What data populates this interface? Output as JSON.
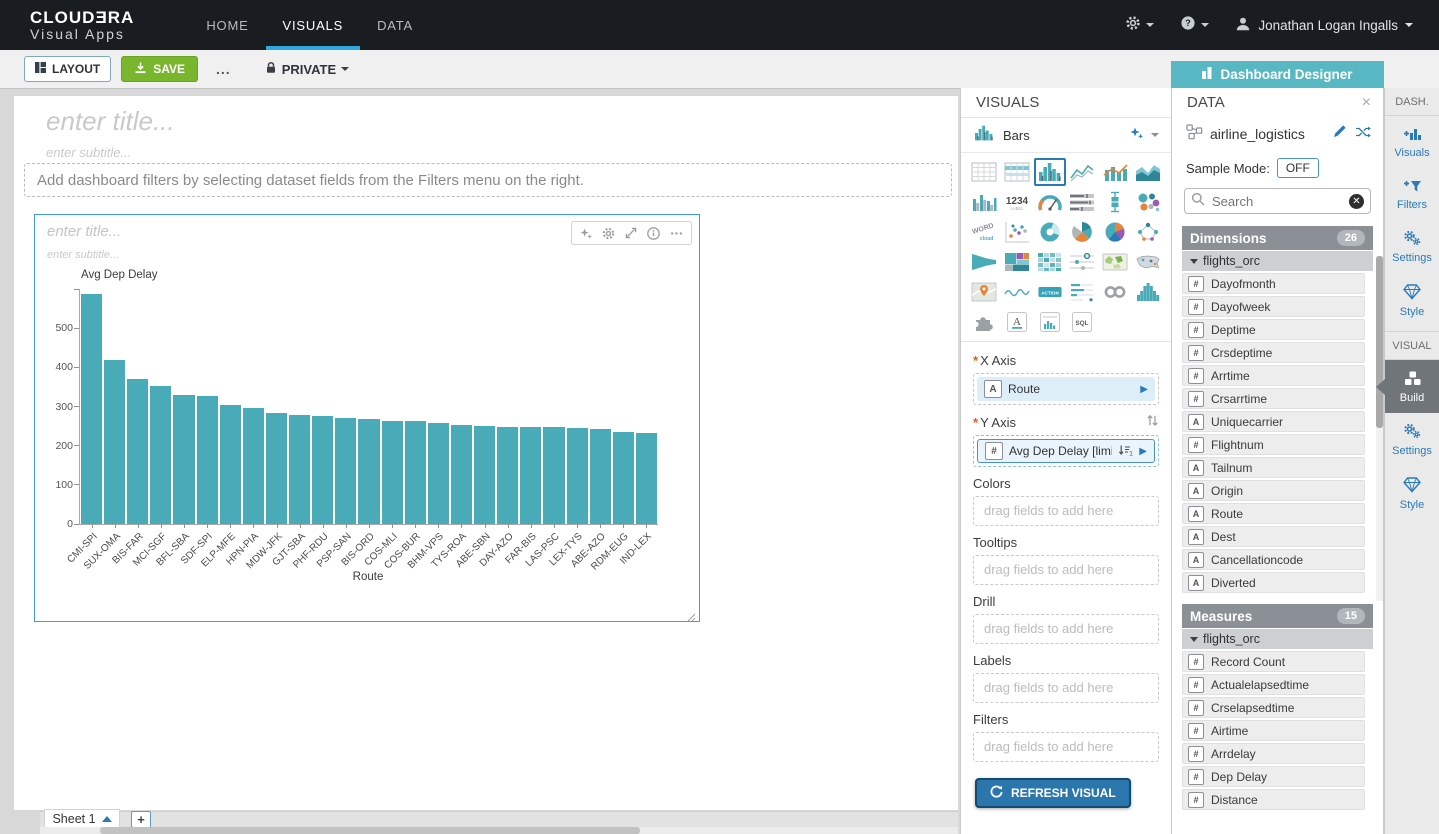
{
  "nav": {
    "brand_line1": "CLOUDƎRA",
    "brand_line2": "Visual Apps",
    "tabs": [
      {
        "label": "HOME",
        "active": false
      },
      {
        "label": "VISUALS",
        "active": true
      },
      {
        "label": "DATA",
        "active": false
      }
    ],
    "icons": [
      "gear-icon",
      "help-icon",
      "user-icon"
    ],
    "user": "Jonathan Logan Ingalls"
  },
  "toolbar": {
    "layout_label": "LAYOUT",
    "save_label": "SAVE",
    "more_label": "...",
    "privacy_label": "PRIVATE",
    "dashboard_designer_label": "Dashboard Designer",
    "accent_green": "#79b62e",
    "accent_teal": "#57b8c4"
  },
  "canvas": {
    "title_placeholder": "enter title...",
    "subtitle_placeholder": "enter subtitle...",
    "filter_hint": "Add dashboard filters by selecting dataset fields from the Filters menu on the right.",
    "sheet_tab_label": "Sheet 1",
    "add_sheet_label": "+"
  },
  "widget": {
    "title_placeholder": "enter title...",
    "subtitle_placeholder": "enter subtitle...",
    "toolbar_icons": [
      "sparkle-icon",
      "gear-icon",
      "expand-icon",
      "info-icon",
      "ellipsis-icon"
    ]
  },
  "chart_data": {
    "type": "bar",
    "title": "Avg Dep Delay",
    "xlabel": "Route",
    "ylabel": "",
    "categories": [
      "CMI-SPI",
      "SUX-OMA",
      "BIS-FAR",
      "MCI-SGF",
      "BFL-SBA",
      "SDF-SPI",
      "ELP-MFE",
      "HPN-PIA",
      "MDW-JFK",
      "GJT-SBA",
      "PHF-RDU",
      "PSP-SAN",
      "BIS-ORD",
      "COS-MLI",
      "COS-BUR",
      "BHM-VPS",
      "TYS-ROA",
      "ABE-SBN",
      "DAY-AZO",
      "FAR-BIS",
      "LAS-PSC",
      "LEX-TYS",
      "ABE-AZO",
      "RDM-EUG",
      "IND-LEX"
    ],
    "values": [
      587,
      420,
      369,
      353,
      330,
      328,
      305,
      296,
      284,
      278,
      277,
      270,
      268,
      263,
      262,
      257,
      254,
      250,
      248,
      247,
      247,
      246,
      243,
      234,
      232
    ],
    "ylim": [
      0,
      600
    ],
    "yticks": [
      0,
      100,
      200,
      300,
      400,
      500
    ],
    "bar_color": "#4aabb8",
    "grid": false,
    "legend": "none"
  },
  "visuals_panel": {
    "header": "VISUALS",
    "selected_type_label": "Bars",
    "type_picker": {
      "selected": "bars",
      "options": [
        "table",
        "crosstab",
        "bars",
        "lines",
        "combo",
        "areas",
        "grouped-bars",
        "kpi",
        "gauge",
        "bullet",
        "box-plot",
        "packed-bubbles",
        "word-cloud",
        "scatter",
        "donut",
        "radial",
        "pie",
        "network",
        "funnel",
        "treemap",
        "heatmap",
        "flow",
        "choropleth-map",
        "usa-map",
        "interactive-map",
        "sparkline",
        "action",
        "legend",
        "links",
        "histogram",
        "extension",
        "rich-text",
        "queries",
        "sql"
      ]
    },
    "x_axis": {
      "label": "X Axis",
      "required": true,
      "field_type": "A",
      "field": "Route"
    },
    "y_axis": {
      "label": "Y Axis",
      "required": true,
      "field_type": "#",
      "field": "Avg Dep Delay [limit ...",
      "sort": "desc-1"
    },
    "drop_sections": [
      {
        "label": "Colors",
        "placeholder": "drag fields to add here"
      },
      {
        "label": "Tooltips",
        "placeholder": "drag fields to add here"
      },
      {
        "label": "Drill",
        "placeholder": "drag fields to add here"
      },
      {
        "label": "Labels",
        "placeholder": "drag fields to add here"
      },
      {
        "label": "Filters",
        "placeholder": "drag fields to add here"
      }
    ],
    "refresh_label": "REFRESH VISUAL"
  },
  "data_panel": {
    "header": "DATA",
    "dataset_name": "airline_logistics",
    "dataset_icons": [
      "dataset-icon",
      "pencil-icon",
      "shuffle-icon"
    ],
    "sample_mode_label": "Sample Mode:",
    "sample_mode_value": "OFF",
    "search_placeholder": "Search",
    "dimensions": {
      "label": "Dimensions",
      "count": "26",
      "group": "flights_orc",
      "fields": [
        {
          "type": "#",
          "name": "Dayofmonth"
        },
        {
          "type": "#",
          "name": "Dayofweek"
        },
        {
          "type": "#",
          "name": "Deptime"
        },
        {
          "type": "#",
          "name": "Crsdeptime"
        },
        {
          "type": "#",
          "name": "Arrtime"
        },
        {
          "type": "#",
          "name": "Crsarrtime"
        },
        {
          "type": "A",
          "name": "Uniquecarrier"
        },
        {
          "type": "#",
          "name": "Flightnum"
        },
        {
          "type": "A",
          "name": "Tailnum"
        },
        {
          "type": "A",
          "name": "Origin"
        },
        {
          "type": "A",
          "name": "Route"
        },
        {
          "type": "A",
          "name": "Dest"
        },
        {
          "type": "A",
          "name": "Cancellationcode"
        },
        {
          "type": "A",
          "name": "Diverted"
        }
      ]
    },
    "measures": {
      "label": "Measures",
      "count": "15",
      "group": "flights_orc",
      "fields": [
        {
          "type": "#",
          "name": "Record Count"
        },
        {
          "type": "#",
          "name": "Actualelapsedtime"
        },
        {
          "type": "#",
          "name": "Crselapsedtime"
        },
        {
          "type": "#",
          "name": "Airtime"
        },
        {
          "type": "#",
          "name": "Arrdelay"
        },
        {
          "type": "#",
          "name": "Dep Delay"
        },
        {
          "type": "#",
          "name": "Distance"
        }
      ]
    }
  },
  "sidebar": {
    "dash_header": "DASH.",
    "dash_items": [
      {
        "icon": "add-visual-icon",
        "label": "Visuals",
        "active": false
      },
      {
        "icon": "add-filter-icon",
        "label": "Filters",
        "active": false
      },
      {
        "icon": "gears-icon",
        "label": "Settings",
        "active": false
      },
      {
        "icon": "diamond-icon",
        "label": "Style",
        "active": false
      }
    ],
    "visual_header": "VISUAL",
    "visual_items": [
      {
        "icon": "build-icon",
        "label": "Build",
        "active": true
      },
      {
        "icon": "gears-icon",
        "label": "Settings",
        "active": false
      },
      {
        "icon": "diamond-icon",
        "label": "Style",
        "active": false
      }
    ]
  }
}
